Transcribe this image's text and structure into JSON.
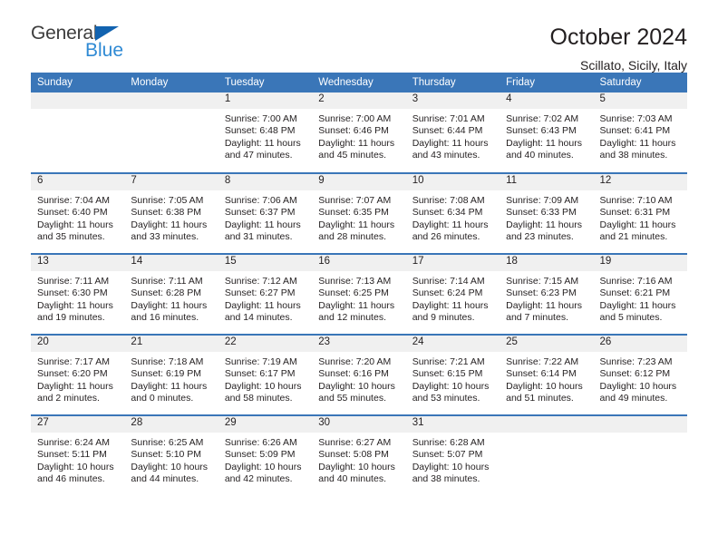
{
  "logo": {
    "text_top": "General",
    "text_bottom": "Blue",
    "triangle_color": "#1263b0",
    "top_color": "#3c3c3c",
    "bottom_color": "#2f8ad4"
  },
  "header": {
    "title": "October 2024",
    "subtitle": "Scillato, Sicily, Italy",
    "accent_color": "#3a76b8",
    "daynum_band_color": "#f0f0f0"
  },
  "weekday_headers": [
    "Sunday",
    "Monday",
    "Tuesday",
    "Wednesday",
    "Thursday",
    "Friday",
    "Saturday"
  ],
  "weeks": [
    [
      {
        "day": "",
        "sunrise": "",
        "sunset": "",
        "daylight_line1": "",
        "daylight_line2": "",
        "empty": true
      },
      {
        "day": "",
        "sunrise": "",
        "sunset": "",
        "daylight_line1": "",
        "daylight_line2": "",
        "empty": true
      },
      {
        "day": "1",
        "sunrise": "Sunrise: 7:00 AM",
        "sunset": "Sunset: 6:48 PM",
        "daylight_line1": "Daylight: 11 hours",
        "daylight_line2": "and 47 minutes."
      },
      {
        "day": "2",
        "sunrise": "Sunrise: 7:00 AM",
        "sunset": "Sunset: 6:46 PM",
        "daylight_line1": "Daylight: 11 hours",
        "daylight_line2": "and 45 minutes."
      },
      {
        "day": "3",
        "sunrise": "Sunrise: 7:01 AM",
        "sunset": "Sunset: 6:44 PM",
        "daylight_line1": "Daylight: 11 hours",
        "daylight_line2": "and 43 minutes."
      },
      {
        "day": "4",
        "sunrise": "Sunrise: 7:02 AM",
        "sunset": "Sunset: 6:43 PM",
        "daylight_line1": "Daylight: 11 hours",
        "daylight_line2": "and 40 minutes."
      },
      {
        "day": "5",
        "sunrise": "Sunrise: 7:03 AM",
        "sunset": "Sunset: 6:41 PM",
        "daylight_line1": "Daylight: 11 hours",
        "daylight_line2": "and 38 minutes."
      }
    ],
    [
      {
        "day": "6",
        "sunrise": "Sunrise: 7:04 AM",
        "sunset": "Sunset: 6:40 PM",
        "daylight_line1": "Daylight: 11 hours",
        "daylight_line2": "and 35 minutes."
      },
      {
        "day": "7",
        "sunrise": "Sunrise: 7:05 AM",
        "sunset": "Sunset: 6:38 PM",
        "daylight_line1": "Daylight: 11 hours",
        "daylight_line2": "and 33 minutes."
      },
      {
        "day": "8",
        "sunrise": "Sunrise: 7:06 AM",
        "sunset": "Sunset: 6:37 PM",
        "daylight_line1": "Daylight: 11 hours",
        "daylight_line2": "and 31 minutes."
      },
      {
        "day": "9",
        "sunrise": "Sunrise: 7:07 AM",
        "sunset": "Sunset: 6:35 PM",
        "daylight_line1": "Daylight: 11 hours",
        "daylight_line2": "and 28 minutes."
      },
      {
        "day": "10",
        "sunrise": "Sunrise: 7:08 AM",
        "sunset": "Sunset: 6:34 PM",
        "daylight_line1": "Daylight: 11 hours",
        "daylight_line2": "and 26 minutes."
      },
      {
        "day": "11",
        "sunrise": "Sunrise: 7:09 AM",
        "sunset": "Sunset: 6:33 PM",
        "daylight_line1": "Daylight: 11 hours",
        "daylight_line2": "and 23 minutes."
      },
      {
        "day": "12",
        "sunrise": "Sunrise: 7:10 AM",
        "sunset": "Sunset: 6:31 PM",
        "daylight_line1": "Daylight: 11 hours",
        "daylight_line2": "and 21 minutes."
      }
    ],
    [
      {
        "day": "13",
        "sunrise": "Sunrise: 7:11 AM",
        "sunset": "Sunset: 6:30 PM",
        "daylight_line1": "Daylight: 11 hours",
        "daylight_line2": "and 19 minutes."
      },
      {
        "day": "14",
        "sunrise": "Sunrise: 7:11 AM",
        "sunset": "Sunset: 6:28 PM",
        "daylight_line1": "Daylight: 11 hours",
        "daylight_line2": "and 16 minutes."
      },
      {
        "day": "15",
        "sunrise": "Sunrise: 7:12 AM",
        "sunset": "Sunset: 6:27 PM",
        "daylight_line1": "Daylight: 11 hours",
        "daylight_line2": "and 14 minutes."
      },
      {
        "day": "16",
        "sunrise": "Sunrise: 7:13 AM",
        "sunset": "Sunset: 6:25 PM",
        "daylight_line1": "Daylight: 11 hours",
        "daylight_line2": "and 12 minutes."
      },
      {
        "day": "17",
        "sunrise": "Sunrise: 7:14 AM",
        "sunset": "Sunset: 6:24 PM",
        "daylight_line1": "Daylight: 11 hours",
        "daylight_line2": "and 9 minutes."
      },
      {
        "day": "18",
        "sunrise": "Sunrise: 7:15 AM",
        "sunset": "Sunset: 6:23 PM",
        "daylight_line1": "Daylight: 11 hours",
        "daylight_line2": "and 7 minutes."
      },
      {
        "day": "19",
        "sunrise": "Sunrise: 7:16 AM",
        "sunset": "Sunset: 6:21 PM",
        "daylight_line1": "Daylight: 11 hours",
        "daylight_line2": "and 5 minutes."
      }
    ],
    [
      {
        "day": "20",
        "sunrise": "Sunrise: 7:17 AM",
        "sunset": "Sunset: 6:20 PM",
        "daylight_line1": "Daylight: 11 hours",
        "daylight_line2": "and 2 minutes."
      },
      {
        "day": "21",
        "sunrise": "Sunrise: 7:18 AM",
        "sunset": "Sunset: 6:19 PM",
        "daylight_line1": "Daylight: 11 hours",
        "daylight_line2": "and 0 minutes."
      },
      {
        "day": "22",
        "sunrise": "Sunrise: 7:19 AM",
        "sunset": "Sunset: 6:17 PM",
        "daylight_line1": "Daylight: 10 hours",
        "daylight_line2": "and 58 minutes."
      },
      {
        "day": "23",
        "sunrise": "Sunrise: 7:20 AM",
        "sunset": "Sunset: 6:16 PM",
        "daylight_line1": "Daylight: 10 hours",
        "daylight_line2": "and 55 minutes."
      },
      {
        "day": "24",
        "sunrise": "Sunrise: 7:21 AM",
        "sunset": "Sunset: 6:15 PM",
        "daylight_line1": "Daylight: 10 hours",
        "daylight_line2": "and 53 minutes."
      },
      {
        "day": "25",
        "sunrise": "Sunrise: 7:22 AM",
        "sunset": "Sunset: 6:14 PM",
        "daylight_line1": "Daylight: 10 hours",
        "daylight_line2": "and 51 minutes."
      },
      {
        "day": "26",
        "sunrise": "Sunrise: 7:23 AM",
        "sunset": "Sunset: 6:12 PM",
        "daylight_line1": "Daylight: 10 hours",
        "daylight_line2": "and 49 minutes."
      }
    ],
    [
      {
        "day": "27",
        "sunrise": "Sunrise: 6:24 AM",
        "sunset": "Sunset: 5:11 PM",
        "daylight_line1": "Daylight: 10 hours",
        "daylight_line2": "and 46 minutes."
      },
      {
        "day": "28",
        "sunrise": "Sunrise: 6:25 AM",
        "sunset": "Sunset: 5:10 PM",
        "daylight_line1": "Daylight: 10 hours",
        "daylight_line2": "and 44 minutes."
      },
      {
        "day": "29",
        "sunrise": "Sunrise: 6:26 AM",
        "sunset": "Sunset: 5:09 PM",
        "daylight_line1": "Daylight: 10 hours",
        "daylight_line2": "and 42 minutes."
      },
      {
        "day": "30",
        "sunrise": "Sunrise: 6:27 AM",
        "sunset": "Sunset: 5:08 PM",
        "daylight_line1": "Daylight: 10 hours",
        "daylight_line2": "and 40 minutes."
      },
      {
        "day": "31",
        "sunrise": "Sunrise: 6:28 AM",
        "sunset": "Sunset: 5:07 PM",
        "daylight_line1": "Daylight: 10 hours",
        "daylight_line2": "and 38 minutes."
      },
      {
        "day": "",
        "sunrise": "",
        "sunset": "",
        "daylight_line1": "",
        "daylight_line2": "",
        "empty": true
      },
      {
        "day": "",
        "sunrise": "",
        "sunset": "",
        "daylight_line1": "",
        "daylight_line2": "",
        "empty": true
      }
    ]
  ]
}
